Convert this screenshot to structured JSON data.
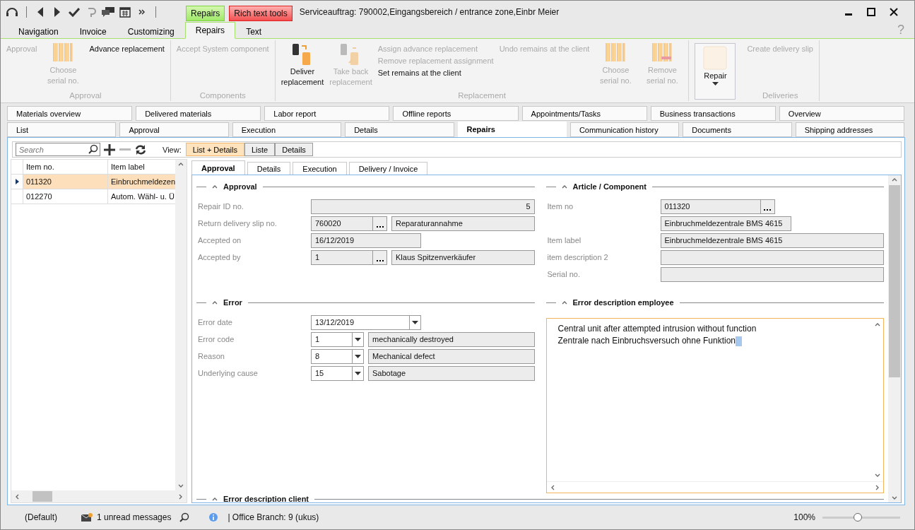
{
  "window": {
    "title": "Serviceauftrag: 790002,Eingangsbereich / entrance zone,Einbr Meier"
  },
  "context_tabs": [
    {
      "label": "Repairs",
      "kind": "green"
    },
    {
      "label": "Rich text tools",
      "kind": "red"
    }
  ],
  "ribbon_tabs": [
    {
      "label": "Navigation",
      "selected": false
    },
    {
      "label": "Invoice",
      "selected": false
    },
    {
      "label": "Customizing",
      "selected": false
    },
    {
      "label": "Repairs",
      "selected": true
    },
    {
      "label": "Text",
      "selected": false
    }
  ],
  "help": "?",
  "ribbon_groups": [
    {
      "label": "Approval",
      "columns": [
        {
          "kind": "stack",
          "entries": [
            {
              "text": "Approval",
              "disabled": true
            }
          ]
        },
        {
          "kind": "large",
          "lines": [
            "Choose",
            "serial no."
          ],
          "disabled": true
        },
        {
          "kind": "stack",
          "entries": [
            {
              "text": "Advance replacement",
              "disabled": false
            }
          ]
        }
      ]
    },
    {
      "label": "Components",
      "columns": [
        {
          "kind": "stack",
          "entries": [
            {
              "text": "Accept System component",
              "disabled": true
            }
          ]
        }
      ]
    },
    {
      "label": "Replacement",
      "columns": [
        {
          "kind": "large",
          "lines": [
            "Deliver",
            "replacement"
          ],
          "disabled": false
        },
        {
          "kind": "large",
          "lines": [
            "Take back",
            "replacement"
          ],
          "disabled": true
        },
        {
          "kind": "stack",
          "entries": [
            {
              "text": "Assign advance replacement",
              "disabled": true
            },
            {
              "text": "Remove replacement assignment",
              "disabled": true
            },
            {
              "text": "Set remains at the client",
              "disabled": false
            }
          ]
        },
        {
          "kind": "stack",
          "entries": [
            {
              "text": "Undo remains at the client",
              "disabled": true
            }
          ]
        },
        {
          "kind": "large",
          "lines": [
            "Choose",
            "serial no."
          ],
          "disabled": true
        },
        {
          "kind": "large",
          "lines": [
            "Remove",
            "serial no."
          ],
          "disabled": true
        }
      ]
    },
    {
      "columns": [
        {
          "kind": "dropdown",
          "lines": [
            "Repair"
          ],
          "disabled": false
        }
      ]
    },
    {
      "label": "Deliveries",
      "columns": [
        {
          "kind": "stack",
          "entries": [
            {
              "text": "Create delivery slip",
              "disabled": true
            }
          ]
        }
      ]
    }
  ],
  "page_tabs": [
    [
      {
        "label": "Materials overview",
        "selected": false
      },
      {
        "label": "Delivered materials",
        "selected": false
      },
      {
        "label": "Labor report",
        "selected": false
      },
      {
        "label": "Offline reports",
        "selected": false
      },
      {
        "label": "Appointments/Tasks",
        "selected": false
      },
      {
        "label": "Business transactions",
        "selected": false
      },
      {
        "label": "Overview",
        "selected": false
      }
    ],
    [
      {
        "label": "List",
        "selected": false
      },
      {
        "label": "Approval",
        "selected": false
      },
      {
        "label": "Execution",
        "selected": false
      },
      {
        "label": "Details",
        "selected": false
      },
      {
        "label": "Repairs",
        "selected": true
      },
      {
        "label": "Communication history",
        "selected": false
      },
      {
        "label": "Documents",
        "selected": false
      },
      {
        "label": "Shipping addresses",
        "selected": false
      }
    ]
  ],
  "toolbar": {
    "search": {
      "placeholder": "Search"
    },
    "view_label": "View:",
    "views": [
      {
        "label": "List + Details",
        "selected": true
      },
      {
        "label": "Liste",
        "selected": false
      },
      {
        "label": "Details",
        "selected": false
      }
    ]
  },
  "list": {
    "columns": [
      "Item no.",
      "Item label"
    ],
    "rows": [
      {
        "cells": [
          "011320",
          "Einbruchmeldezen"
        ],
        "selected": true
      },
      {
        "cells": [
          "012270",
          "Autom. Wähl- u. Ü"
        ],
        "selected": false
      }
    ]
  },
  "detail_tabs": [
    {
      "label": "Approval",
      "selected": true
    },
    {
      "label": "Details",
      "selected": false
    },
    {
      "label": "Execution",
      "selected": false
    },
    {
      "label": "Delivery / Invoice",
      "selected": false
    }
  ],
  "sections": [
    {
      "title": "Approval",
      "fields": [
        {
          "label": "Repair ID no.",
          "kind": "number",
          "value": "5"
        },
        {
          "label": "Return delivery slip no.",
          "kind": "lookup",
          "value": "760020",
          "text": "Reparaturannahme"
        },
        {
          "label": "Accepted on",
          "kind": "half",
          "value": "16/12/2019"
        },
        {
          "label": "Accepted by",
          "kind": "lookup",
          "value": "1",
          "text": "Klaus Spitzenverkäufer"
        }
      ]
    },
    {
      "title": "Article / Component",
      "fields": [
        {
          "label": "Item no",
          "kind": "lookup-short",
          "value": "011320"
        },
        {
          "kind": "half",
          "value": "Einbruchmeldezentrale BMS 4615"
        },
        {
          "label": "Item label",
          "kind": "full",
          "value": "Einbruchmeldezentrale BMS 4615"
        },
        {
          "label": "item description 2",
          "kind": "full"
        },
        {
          "label": "Serial no.",
          "kind": "full"
        }
      ]
    },
    {
      "title": "Error",
      "fields": [
        {
          "label": "Error date",
          "kind": "datepicker",
          "value": "13/12/2019"
        },
        {
          "label": "Error code",
          "kind": "combo",
          "value": "1",
          "text": "mechanically destroyed"
        },
        {
          "label": "Reason",
          "kind": "combo",
          "value": "8",
          "text": "Mechanical defect"
        },
        {
          "label": "Underlying cause",
          "kind": "combo",
          "value": "15",
          "text": "Sabotage"
        }
      ]
    },
    {
      "title": "Error description employee",
      "kind": "memo",
      "lines": [
        "Central unit after attempted intrusion without function",
        "Zentrale nach Einbruchsversuch ohne Funktion"
      ]
    },
    {
      "title": "Error description client"
    }
  ],
  "status_bar": {
    "profile": "(Default)",
    "messages": "1 unread messages",
    "branch": "| Office Branch:  9 (ukus)",
    "zoom": "100%",
    "zoom_slider": {
      "level": 0.45
    }
  }
}
